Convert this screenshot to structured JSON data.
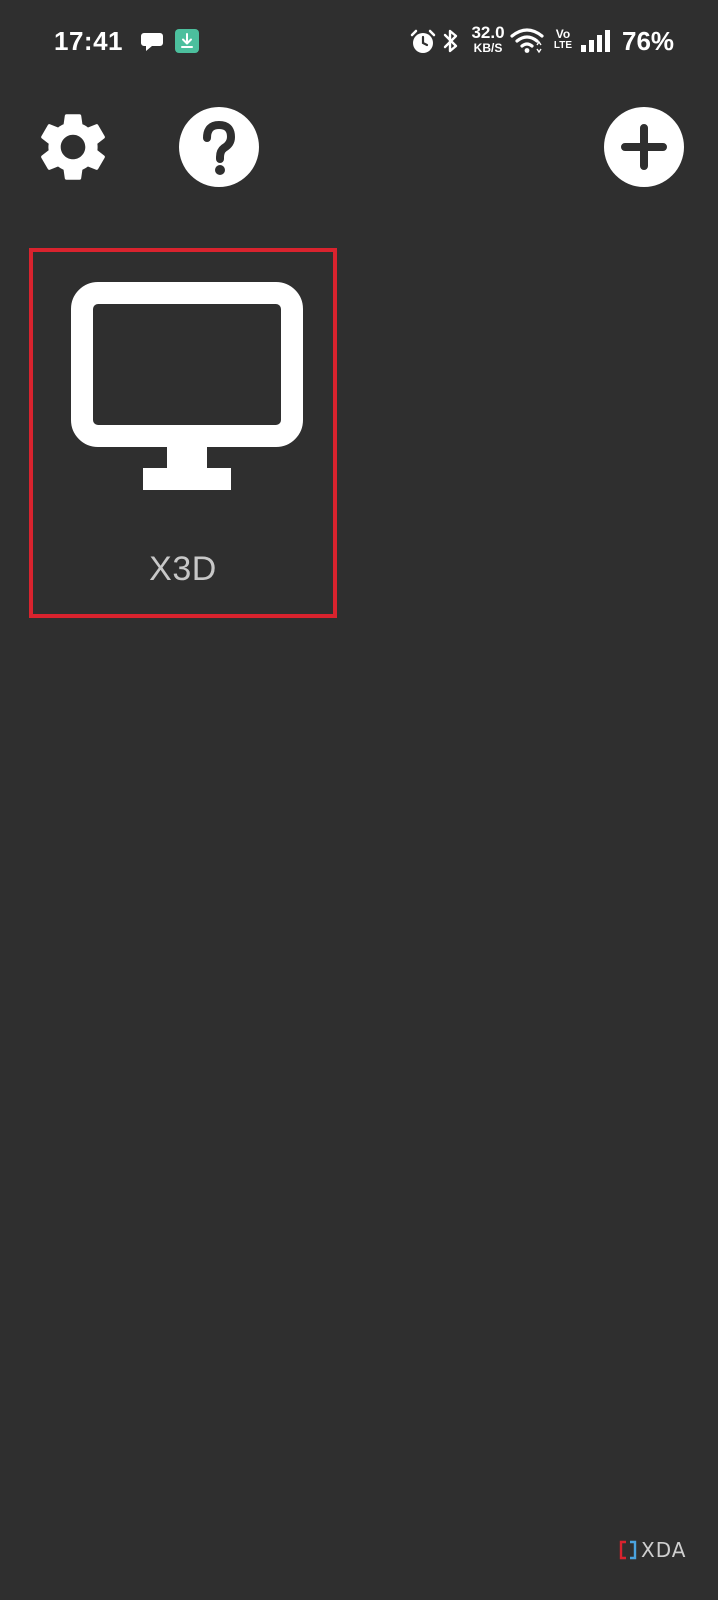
{
  "status_bar": {
    "time": "17:41",
    "net_speed_value": "32.0",
    "net_speed_unit": "KB/S",
    "volte_top": "Vo",
    "volte_bottom": "LTE",
    "battery": "76%"
  },
  "icons": {
    "chat": "chat-bubble-icon",
    "download": "download-icon",
    "alarm": "alarm-icon",
    "bluetooth": "bluetooth-icon",
    "wifi": "wifi-icon",
    "signal": "signal-icon",
    "settings": "gear-icon",
    "help": "help-icon",
    "add": "plus-icon",
    "desktop": "monitor-icon"
  },
  "desktops": [
    {
      "label": "X3D"
    }
  ],
  "watermark": {
    "text": "XDA"
  },
  "colors": {
    "background": "#2f2f2f",
    "selection_border": "#d9232e",
    "download_badge": "#4cbf9d",
    "label_text": "#c8c8c8"
  }
}
